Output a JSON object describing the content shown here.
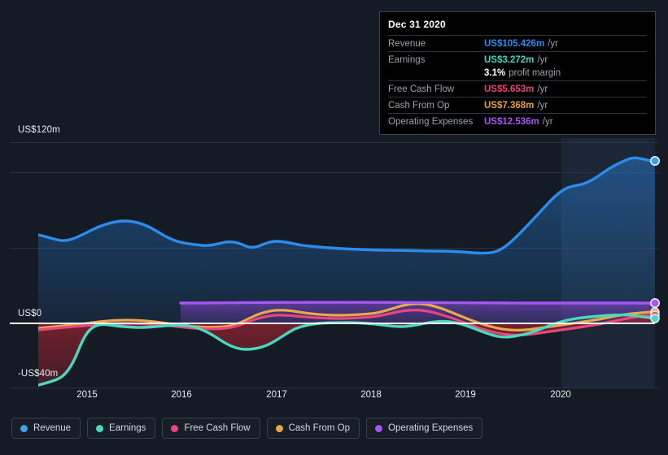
{
  "axis": {
    "y_labels": [
      {
        "text": "US$120m",
        "value": 120
      },
      {
        "text": "US$0",
        "value": 0
      },
      {
        "text": "-US$40m",
        "value": -40
      }
    ],
    "x_labels": [
      "2015",
      "2016",
      "2017",
      "2018",
      "2019",
      "2020"
    ]
  },
  "tooltip": {
    "date": "Dec 31 2020",
    "rows": [
      {
        "key": "Revenue",
        "value": "US$105.426m",
        "suffix": "/yr",
        "color": "#2b8ced"
      },
      {
        "key": "Earnings",
        "value": "US$3.272m",
        "suffix": "/yr",
        "color": "#3fd9c0"
      },
      {
        "key": "",
        "value": "3.1%",
        "suffix": "profit margin",
        "color": "#ffffff"
      },
      {
        "key": "Free Cash Flow",
        "value": "US$5.653m",
        "suffix": "/yr",
        "color": "#e8427a"
      },
      {
        "key": "Cash From Op",
        "value": "US$7.368m",
        "suffix": "/yr",
        "color": "#e9a13c"
      },
      {
        "key": "Operating Expenses",
        "value": "US$12.536m",
        "suffix": "/yr",
        "color": "#a855f0"
      }
    ]
  },
  "legend": [
    {
      "label": "Revenue",
      "color": "#3ba3e8"
    },
    {
      "label": "Earnings",
      "color": "#4ad9c0"
    },
    {
      "label": "Free Cash Flow",
      "color": "#e8467c"
    },
    {
      "label": "Cash From Op",
      "color": "#e9a94a"
    },
    {
      "label": "Operating Expenses",
      "color": "#a855f7"
    }
  ],
  "chart_data": {
    "type": "area",
    "title": "",
    "xlabel": "",
    "ylabel": "US$m",
    "ylim": [
      -48,
      128
    ],
    "xlim": [
      "2014-07",
      "2021-01"
    ],
    "grid": true,
    "legend_position": "bottom",
    "currency": "US$m",
    "x": [
      "2014-07",
      "2014-10",
      "2015-01",
      "2015-04",
      "2015-07",
      "2015-10",
      "2016-01",
      "2016-04",
      "2016-07",
      "2016-10",
      "2017-01",
      "2017-04",
      "2017-07",
      "2017-10",
      "2018-01",
      "2018-04",
      "2018-07",
      "2018-10",
      "2019-01",
      "2019-04",
      "2019-07",
      "2019-10",
      "2020-01",
      "2020-04",
      "2020-07",
      "2020-10",
      "2020-12"
    ],
    "series": [
      {
        "name": "Revenue",
        "color": "#2b8ced",
        "values": [
          58.5,
          56.5,
          58.0,
          61.5,
          64.5,
          66.0,
          65.5,
          63.5,
          61.0,
          58.5,
          56.0,
          58.0,
          56.5,
          55.5,
          55.0,
          54.5,
          54.5,
          54.5,
          54.5,
          54.0,
          53.0,
          55.0,
          63.0,
          72.0,
          84.0,
          95.0,
          105.426
        ]
      },
      {
        "name": "Earnings",
        "color": "#3fd9c0",
        "values": [
          -41.0,
          -40.0,
          -36.0,
          -20.0,
          -6.0,
          -3.0,
          -3.5,
          -4.0,
          -5.0,
          -7.5,
          -9.5,
          -10.5,
          -10.5,
          -9.5,
          -5.5,
          -2.5,
          -2.0,
          -2.5,
          -1.5,
          -0.5,
          -1.0,
          -3.5,
          -5.5,
          -4.5,
          -2.0,
          0.5,
          3.272
        ]
      },
      {
        "name": "Free Cash Flow",
        "color": "#e8427a",
        "values": [
          -3.0,
          -2.5,
          -2.0,
          -1.5,
          -1.0,
          -0.8,
          -1.2,
          -2.0,
          -2.5,
          -2.0,
          -1.0,
          0.5,
          0.8,
          0.5,
          0.2,
          0.5,
          1.5,
          1.8,
          0.8,
          -0.5,
          -2.5,
          -4.5,
          -5.5,
          -4.0,
          -1.0,
          2.0,
          5.653
        ]
      },
      {
        "name": "Cash From Op",
        "color": "#e9a13c",
        "values": [
          -2.0,
          -1.5,
          -1.0,
          -0.5,
          0.2,
          0.8,
          0.5,
          -0.5,
          -1.0,
          -0.5,
          0.8,
          2.2,
          2.5,
          2.0,
          1.5,
          2.0,
          3.0,
          3.5,
          2.0,
          0.5,
          -1.5,
          -3.5,
          -4.5,
          -3.0,
          0.0,
          3.5,
          7.368
        ]
      },
      {
        "name": "Operating Expenses",
        "color": "#a855f0",
        "values": [
          null,
          null,
          null,
          null,
          null,
          null,
          11.8,
          11.9,
          11.9,
          12.0,
          12.0,
          12.1,
          12.1,
          12.0,
          12.0,
          12.0,
          12.1,
          12.2,
          12.2,
          12.1,
          12.0,
          12.0,
          12.1,
          12.2,
          12.3,
          12.4,
          12.536
        ]
      }
    ],
    "annotations": {
      "forecast_band_start": "2020-04",
      "end_markers": true
    }
  }
}
